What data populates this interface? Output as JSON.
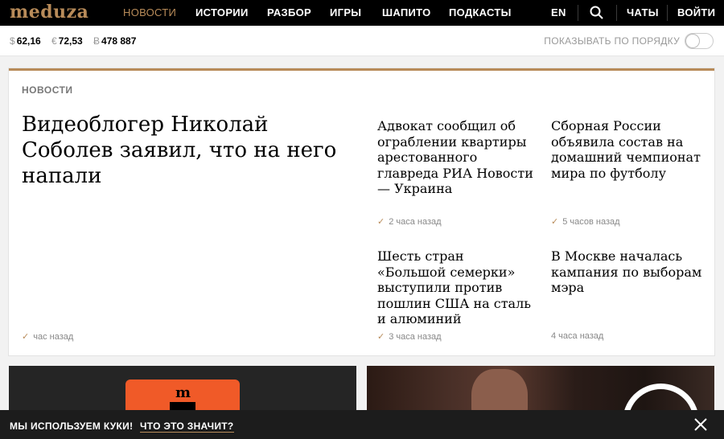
{
  "logo": "meduza",
  "nav": {
    "items": [
      "НОВОСТИ",
      "ИСТОРИИ",
      "РАЗБОР",
      "ИГРЫ",
      "ШАПИТО",
      "ПОДКАСТЫ"
    ],
    "lang": "EN",
    "chats": "ЧАТЫ",
    "login": "ВОЙТИ"
  },
  "rates": [
    {
      "symbol": "$",
      "value": "62,16"
    },
    {
      "symbol": "€",
      "value": "72,53"
    },
    {
      "symbol": "Ƀ",
      "value": "478 887"
    }
  ],
  "order_toggle": {
    "label": "ПОКАЗЫВАТЬ ПО ПОРЯДКУ",
    "on": false
  },
  "news": {
    "section": "НОВОСТИ",
    "main": {
      "title": "Видеоблогер Николай Соболев заявил, что на него напали",
      "time": "час назад"
    },
    "items": [
      {
        "title": "Адвокат сообщил об ограблении квартиры арестованного главреда РИА Новости — Украина",
        "time": "2 часа назад"
      },
      {
        "title": "Сборная России объявила состав на домашний чемпионат мира по футболу",
        "time": "5 часов назад"
      },
      {
        "title": "Шесть стран «Большой семерки» выступили против пошлин США на сталь и алюминий",
        "time": "3 часа назад"
      },
      {
        "title": "В Москве началась кампания по выборам мэра",
        "time": "4 часа назад"
      }
    ]
  },
  "promo": {
    "logo": "m"
  },
  "cookie": {
    "text": "МЫ ИСПОЛЬЗУЕМ КУКИ!",
    "link": "ЧТО ЭТО ЗНАЧИТ?"
  },
  "colors": {
    "accent": "#b88b59",
    "topbar": "#000000",
    "promo_orange": "#f05a28"
  }
}
